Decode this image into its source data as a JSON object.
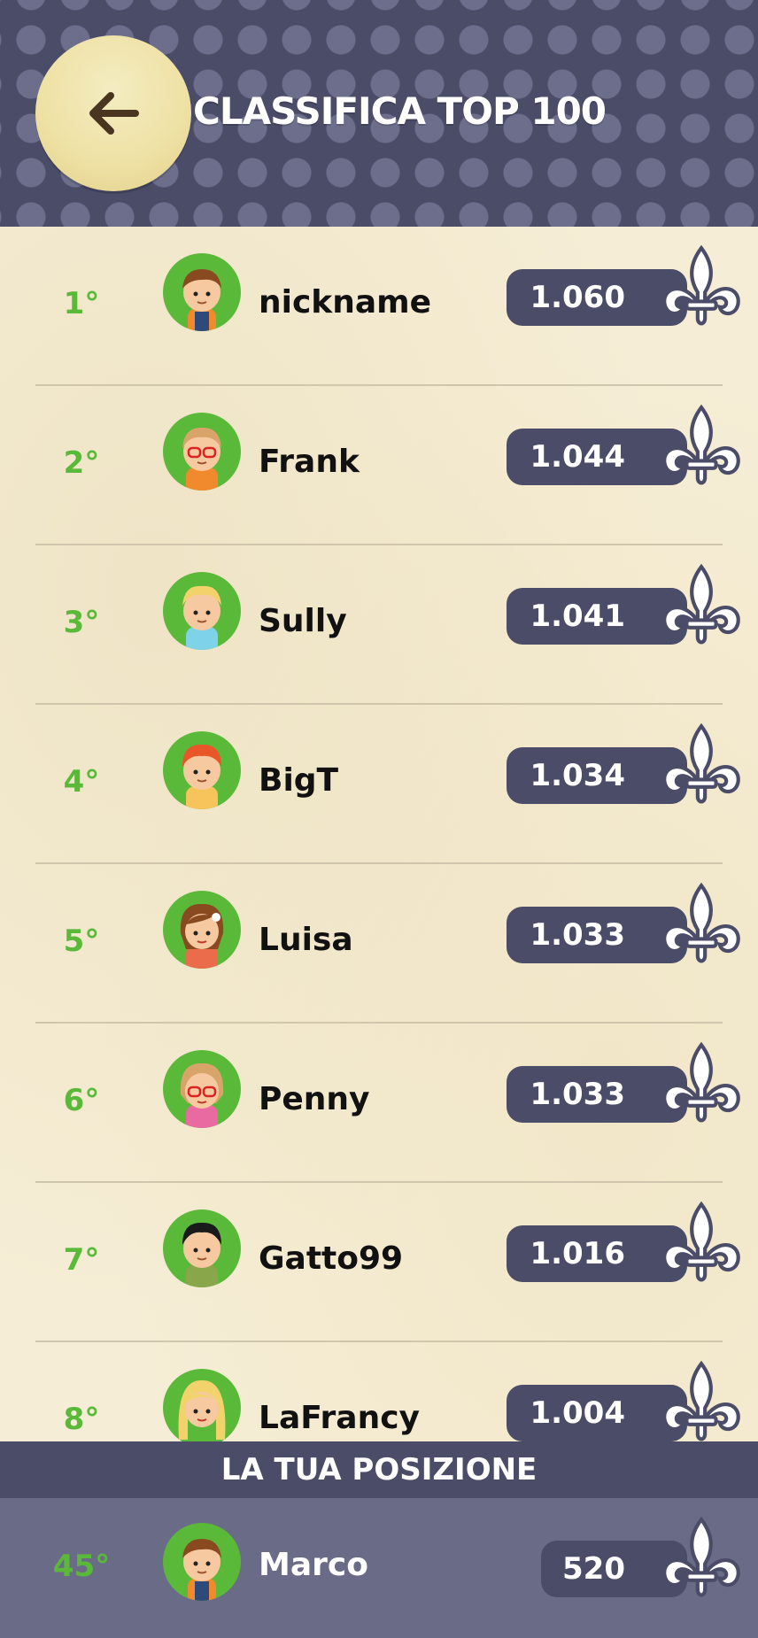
{
  "header": {
    "title": "CLASSIFICA TOP 100",
    "back_icon": "arrow-left-icon"
  },
  "colors": {
    "header_bg": "#4b4c68",
    "rank_green": "#5bb93a",
    "pill_bg": "#4b4c68",
    "back_button": "#efe2a6"
  },
  "leaderboard": [
    {
      "rank": "1°",
      "name": "nickname",
      "score": "1.060"
    },
    {
      "rank": "2°",
      "name": "Frank",
      "score": "1.044"
    },
    {
      "rank": "3°",
      "name": "Sully",
      "score": "1.041"
    },
    {
      "rank": "4°",
      "name": "BigT",
      "score": "1.034"
    },
    {
      "rank": "5°",
      "name": "Luisa",
      "score": "1.033"
    },
    {
      "rank": "6°",
      "name": "Penny",
      "score": "1.033"
    },
    {
      "rank": "7°",
      "name": "Gatto99",
      "score": "1.016"
    },
    {
      "rank": "8°",
      "name": "LaFrancy",
      "score": "1.004"
    }
  ],
  "your_position": {
    "label": "LA TUA POSIZIONE",
    "rank": "45°",
    "name": "Marco",
    "score": "520"
  },
  "score_icon": "fleur-de-lis-icon"
}
